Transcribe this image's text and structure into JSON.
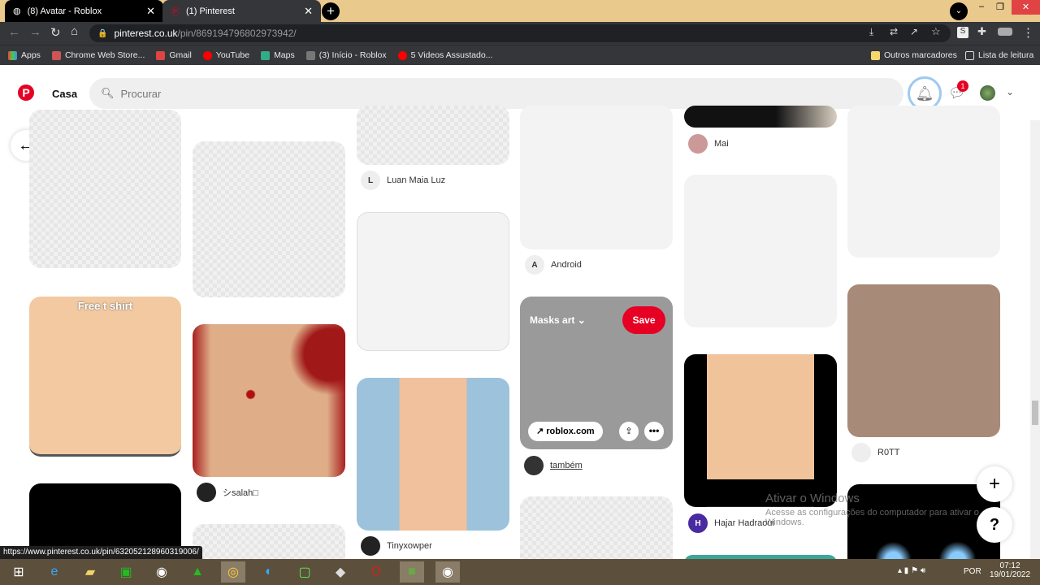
{
  "browser": {
    "tabs": [
      {
        "title": "(8) Avatar - Roblox",
        "icon": "globe-icon"
      },
      {
        "title": "(1) Pinterest",
        "icon": "pinterest-icon"
      }
    ],
    "url_host": "pinterest.co.uk",
    "url_path": "/pin/869194796802973942/",
    "bookmarks": [
      "Apps",
      "Chrome Web Store...",
      "Gmail",
      "YouTube",
      "Maps",
      "(3) Início - Roblox",
      "5 Videos Assustado..."
    ],
    "other_bookmarks": "Outros marcadores",
    "reading_list": "Lista de leitura",
    "status_url": "https://www.pinterest.co.uk/pin/632052128960319006/"
  },
  "pinterest": {
    "home": "Casa",
    "search_placeholder": "Procurar",
    "message_badge": "1",
    "brand_color": "#e60023",
    "pins": {
      "free_shirt": "Free t shirt",
      "salah": "シsalah□",
      "luan": "Luan Maia Luz",
      "luan_initial": "L",
      "tinyx": "Tinyxowper",
      "android": "Android",
      "android_initial": "A",
      "board": "Masks art",
      "save": "Save",
      "link": "roblox.com",
      "tambem": "também",
      "mai": "Mai",
      "hajar": "Hajar Hadraoui",
      "hajar_initial": "H",
      "rott": "R0TT"
    },
    "help": "?",
    "plus": "+"
  },
  "watermark": {
    "title": "Ativar o Windows",
    "text": "Acesse as configurações do computador para ativar o Windows."
  },
  "taskbar": {
    "lang": "POR",
    "time": "07:12",
    "date": "19/01/2022"
  }
}
